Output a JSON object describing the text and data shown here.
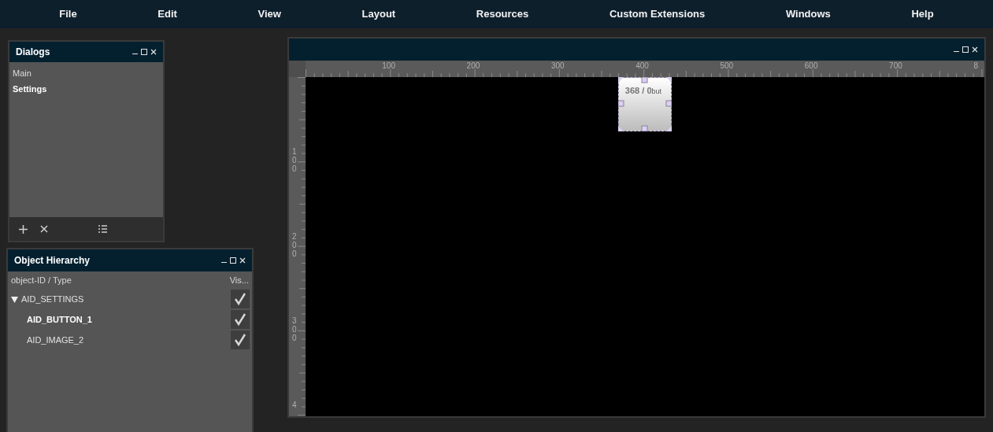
{
  "menu": [
    "File",
    "Edit",
    "View",
    "Layout",
    "Resources",
    "Custom Extensions",
    "Windows",
    "Help"
  ],
  "dialogs_panel": {
    "title": "Dialogs",
    "items": [
      {
        "label": "Main",
        "selected": false
      },
      {
        "label": "Settings",
        "selected": true
      }
    ]
  },
  "hierarchy_panel": {
    "title": "Object Hierarchy",
    "columns": [
      "object-ID / Type",
      "Vis..."
    ],
    "tree": [
      {
        "label": "AID_SETTINGS",
        "expanded": true,
        "selected": false,
        "visible": true,
        "children": [
          {
            "label": "AID_BUTTON_1",
            "selected": true,
            "visible": true
          },
          {
            "label": "AID_IMAGE_2",
            "selected": false,
            "visible": true
          }
        ]
      }
    ]
  },
  "editor": {
    "top_ruler": [
      "100",
      "200",
      "300",
      "400",
      "500",
      "600",
      "700",
      "8"
    ],
    "left_ruler": [
      "100",
      "200",
      "300",
      "4"
    ],
    "widget": {
      "position": "368 / 0",
      "name": "but",
      "selected": true
    }
  }
}
